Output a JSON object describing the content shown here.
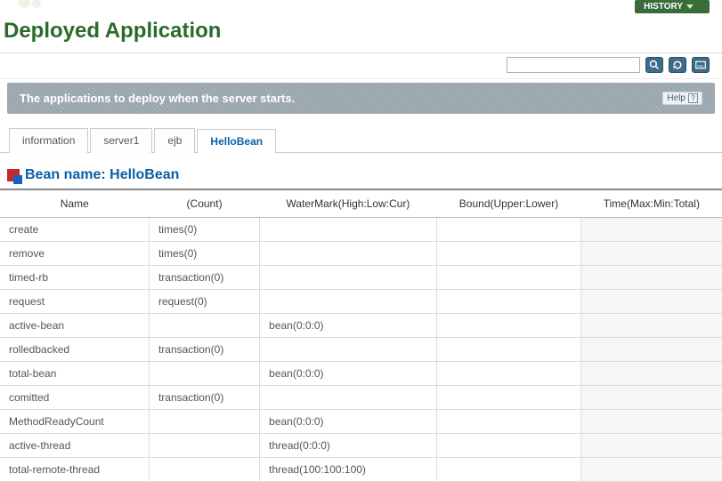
{
  "header": {
    "history_label": "HISTORY",
    "page_title": "Deployed Application"
  },
  "search": {
    "value": "",
    "placeholder": ""
  },
  "descbar": {
    "text": "The applications to deploy when the server starts.",
    "help_label": "Help"
  },
  "tabs": [
    {
      "label": "information",
      "active": false
    },
    {
      "label": "server1",
      "active": false
    },
    {
      "label": "ejb",
      "active": false
    },
    {
      "label": "HelloBean",
      "active": true
    }
  ],
  "section": {
    "title": "Bean name: HelloBean"
  },
  "table": {
    "columns": [
      "Name",
      "(Count)",
      "WaterMark(High:Low:Cur)",
      "Bound(Upper:Lower)",
      "Time(Max:Min:Total)"
    ],
    "rows": [
      {
        "name": "create",
        "count": "times(0)",
        "watermark": "",
        "bound": "",
        "time": ""
      },
      {
        "name": "remove",
        "count": "times(0)",
        "watermark": "",
        "bound": "",
        "time": ""
      },
      {
        "name": "timed-rb",
        "count": "transaction(0)",
        "watermark": "",
        "bound": "",
        "time": ""
      },
      {
        "name": "request",
        "count": "request(0)",
        "watermark": "",
        "bound": "",
        "time": ""
      },
      {
        "name": "active-bean",
        "count": "",
        "watermark": "bean(0:0:0)",
        "bound": "",
        "time": ""
      },
      {
        "name": "rolledbacked",
        "count": "transaction(0)",
        "watermark": "",
        "bound": "",
        "time": ""
      },
      {
        "name": "total-bean",
        "count": "",
        "watermark": "bean(0:0:0)",
        "bound": "",
        "time": ""
      },
      {
        "name": "comitted",
        "count": "transaction(0)",
        "watermark": "",
        "bound": "",
        "time": ""
      },
      {
        "name": "MethodReadyCount",
        "count": "",
        "watermark": "bean(0:0:0)",
        "bound": "",
        "time": ""
      },
      {
        "name": "active-thread",
        "count": "",
        "watermark": "thread(0:0:0)",
        "bound": "",
        "time": ""
      },
      {
        "name": "total-remote-thread",
        "count": "",
        "watermark": "thread(100:100:100)",
        "bound": "",
        "time": ""
      }
    ]
  }
}
